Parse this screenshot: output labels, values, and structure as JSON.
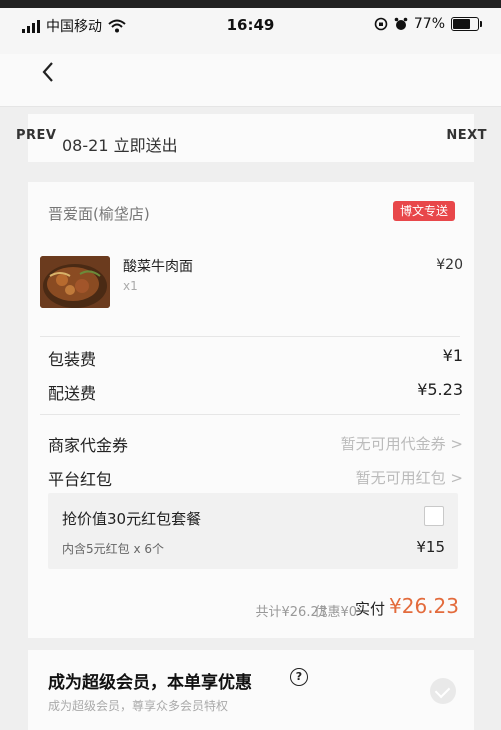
{
  "status": {
    "carrier": "中国移动",
    "time": "16:49",
    "battery": "77%",
    "battery_level": 0.77
  },
  "nav": {
    "prev": "PREV",
    "next": "NEXT"
  },
  "delivery": {
    "text": "08-21 立即送出"
  },
  "shop": {
    "name": "晋爱面(榆垡店)",
    "tag": "博文专送"
  },
  "item": {
    "name": "酸菜牛肉面",
    "qty": "x1",
    "price": "¥20"
  },
  "fees": [
    {
      "label": "包装费",
      "value": "¥1"
    },
    {
      "label": "配送费",
      "value": "¥5.23"
    }
  ],
  "vouchers": [
    {
      "label": "商家代金券",
      "value": "暂无可用代金券 >"
    },
    {
      "label": "平台红包",
      "value": "暂无可用红包 >"
    }
  ],
  "package": {
    "title": "抢价值30元红包套餐",
    "desc": "内含5元红包 x 6个",
    "price": "¥15"
  },
  "total": {
    "sum": "共计¥26.23",
    "discount": "优惠¥0",
    "paid_label": "实付",
    "paid_amount": "¥26.23"
  },
  "vip": {
    "title": "成为超级会员，本单享优惠",
    "help": "?",
    "subtitle": "成为超级会员，尊享众多会员特权"
  }
}
